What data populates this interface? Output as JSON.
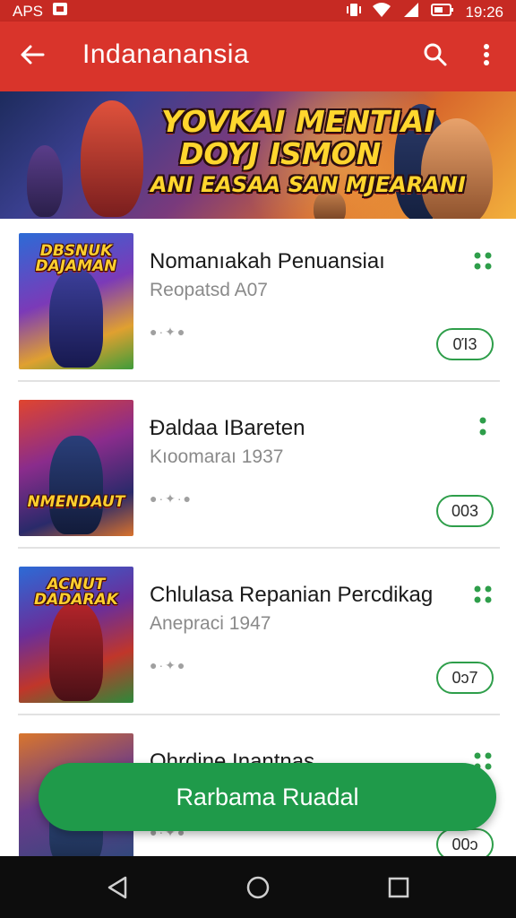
{
  "status_bar": {
    "left_text": "APS",
    "time": "19:26"
  },
  "app_bar": {
    "title": "Indananansia"
  },
  "banner": {
    "line1": "YOVKAI MENTIAI",
    "line2": "DOYJ ISMON",
    "line3": "ANI EASAA SAN MJEARANI"
  },
  "items": [
    {
      "title": "Nomanıakah Penuansiaı",
      "subtitle": "Reopatsd A07",
      "meta": "●·✦●",
      "badge": "0Ί3",
      "thumb_text": "DBSNUK DAJAMAN"
    },
    {
      "title": "Đaldaa IBareten",
      "subtitle": "Kıoomaraı 1937",
      "meta": "●·✦·●",
      "badge": "003",
      "thumb_text": "NMENDAUT"
    },
    {
      "title": "Chlulasa Repanian Percdikag",
      "subtitle": "Anepraci 1947",
      "meta": "●·✦●",
      "badge": "0ɔ7",
      "thumb_text": "ACNUT DADARAK"
    },
    {
      "title": "Ohrdine Inantnas",
      "subtitle": "",
      "meta": "●·✦●",
      "badge": "00ɔ",
      "thumb_text": ""
    }
  ],
  "fab": {
    "label": "Rarbama Ruadal"
  },
  "colors": {
    "primary": "#d9342b",
    "accent": "#1f9a4a",
    "badge_border": "#2e9e4a"
  }
}
